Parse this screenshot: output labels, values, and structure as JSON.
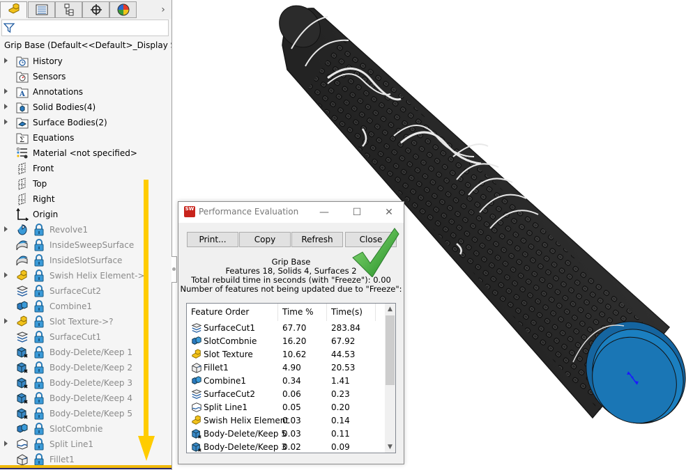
{
  "feature_manager": {
    "tabs": [
      {
        "name": "FeatureManager design tree",
        "icon": "part-icon",
        "active": true
      },
      {
        "name": "PropertyManager",
        "icon": "property-manager-icon",
        "active": false
      },
      {
        "name": "ConfigurationManager",
        "icon": "configuration-manager-icon",
        "active": false
      },
      {
        "name": "DimXpertManager",
        "icon": "crosshair-icon",
        "active": false
      },
      {
        "name": "DisplayManager",
        "icon": "display-manager-icon",
        "active": false
      }
    ],
    "more_tabs_glyph": "›",
    "filter": {
      "icon": "filter-icon",
      "value": ""
    },
    "root": {
      "label": "Grip Base  (Default<<Default>_Display Sta",
      "icon": "part-icon"
    },
    "items": [
      {
        "label": "History",
        "icon": "history-folder-icon",
        "expandable": true,
        "suppressed": false
      },
      {
        "label": "Sensors",
        "icon": "sensors-folder-icon",
        "expandable": false,
        "suppressed": false
      },
      {
        "label": "Annotations",
        "icon": "annotations-folder-icon",
        "expandable": true,
        "suppressed": false
      },
      {
        "label": "Solid Bodies(4)",
        "icon": "solid-bodies-folder-icon",
        "expandable": true,
        "suppressed": false
      },
      {
        "label": "Surface Bodies(2)",
        "icon": "surface-bodies-folder-icon",
        "expandable": true,
        "suppressed": false
      },
      {
        "label": "Equations",
        "icon": "equations-folder-icon",
        "expandable": false,
        "suppressed": false
      },
      {
        "label": "Material <not specified>",
        "icon": "material-icon",
        "expandable": false,
        "suppressed": false
      },
      {
        "label": "Front",
        "icon": "plane-icon",
        "expandable": false,
        "suppressed": false
      },
      {
        "label": "Top",
        "icon": "plane-icon",
        "expandable": false,
        "suppressed": false
      },
      {
        "label": "Right",
        "icon": "plane-icon",
        "expandable": false,
        "suppressed": false
      },
      {
        "label": "Origin",
        "icon": "origin-icon",
        "expandable": false,
        "suppressed": false
      },
      {
        "label": "Revolve1",
        "icon": "revolve-icon",
        "expandable": true,
        "suppressed": true
      },
      {
        "label": "InsideSweepSurface",
        "icon": "surface-icon",
        "expandable": false,
        "suppressed": true
      },
      {
        "label": "InsideSlotSurface",
        "icon": "surface-icon",
        "expandable": false,
        "suppressed": true
      },
      {
        "label": "Swish Helix Element->?",
        "icon": "library-feature-icon",
        "expandable": true,
        "suppressed": true
      },
      {
        "label": "SurfaceCut2",
        "icon": "surface-cut-icon",
        "expandable": false,
        "suppressed": true
      },
      {
        "label": "Combine1",
        "icon": "combine-icon",
        "expandable": false,
        "suppressed": true
      },
      {
        "label": "Slot Texture->?",
        "icon": "library-feature-icon",
        "expandable": true,
        "suppressed": true
      },
      {
        "label": "SurfaceCut1",
        "icon": "surface-cut-icon",
        "expandable": false,
        "suppressed": true
      },
      {
        "label": "Body-Delete/Keep 1",
        "icon": "body-delete-icon",
        "expandable": false,
        "suppressed": true
      },
      {
        "label": "Body-Delete/Keep 2",
        "icon": "body-delete-icon",
        "expandable": false,
        "suppressed": true
      },
      {
        "label": "Body-Delete/Keep 3",
        "icon": "body-delete-icon",
        "expandable": false,
        "suppressed": true
      },
      {
        "label": "Body-Delete/Keep 4",
        "icon": "body-delete-icon",
        "expandable": false,
        "suppressed": true
      },
      {
        "label": "Body-Delete/Keep 5",
        "icon": "body-delete-icon",
        "expandable": false,
        "suppressed": true
      },
      {
        "label": "SlotCombnie",
        "icon": "combine-icon",
        "expandable": false,
        "suppressed": true
      },
      {
        "label": "Split Line1",
        "icon": "split-line-icon",
        "expandable": true,
        "suppressed": true
      },
      {
        "label": "Fillet1",
        "icon": "fillet-icon",
        "expandable": false,
        "suppressed": true
      }
    ],
    "annotation_arrow_color": "#ffcc00"
  },
  "dialog": {
    "title": "Performance Evaluation",
    "window_controls": {
      "minimize": "—",
      "maximize": "☐",
      "close": "✕"
    },
    "buttons": {
      "print": "Print...",
      "copy": "Copy",
      "refresh": "Refresh",
      "close": "Close"
    },
    "info": {
      "part_name": "Grip Base",
      "summary": "Features 18, Solids 4, Surfaces 2",
      "rebuild_time": "Total rebuild time in seconds (with \"Freeze\"): 0.00",
      "frozen_count": "Number of features not being updated due to \"Freeze\":"
    },
    "table": {
      "columns": [
        "Feature Order",
        "Time %",
        "Time(s)"
      ],
      "rows": [
        {
          "feature": "SurfaceCut1",
          "icon": "surface-cut-icon",
          "pct": "67.70",
          "time": "283.84"
        },
        {
          "feature": "SlotCombnie",
          "icon": "combine-icon",
          "pct": "16.20",
          "time": "67.92"
        },
        {
          "feature": "Slot Texture",
          "icon": "library-feature-icon",
          "pct": "10.62",
          "time": "44.53"
        },
        {
          "feature": "Fillet1",
          "icon": "fillet-icon",
          "pct": "4.90",
          "time": "20.53"
        },
        {
          "feature": "Combine1",
          "icon": "combine-icon",
          "pct": "0.34",
          "time": "1.41"
        },
        {
          "feature": "SurfaceCut2",
          "icon": "surface-cut-icon",
          "pct": "0.06",
          "time": "0.23"
        },
        {
          "feature": "Split Line1",
          "icon": "split-line-icon",
          "pct": "0.05",
          "time": "0.20"
        },
        {
          "feature": "Swish Helix Element",
          "icon": "library-feature-icon",
          "pct": "0.03",
          "time": "0.14"
        },
        {
          "feature": "Body-Delete/Keep 5",
          "icon": "body-delete-icon",
          "pct": "0.03",
          "time": "0.11"
        },
        {
          "feature": "Body-Delete/Keep 3",
          "icon": "body-delete-icon",
          "pct": "0.02",
          "time": "0.09"
        }
      ]
    },
    "checkmark_color": "#3aa935"
  },
  "viewport": {
    "model": "Grip Base",
    "grip_color": "#2e2e2e",
    "end_cap_color": "#1b7fc0"
  }
}
